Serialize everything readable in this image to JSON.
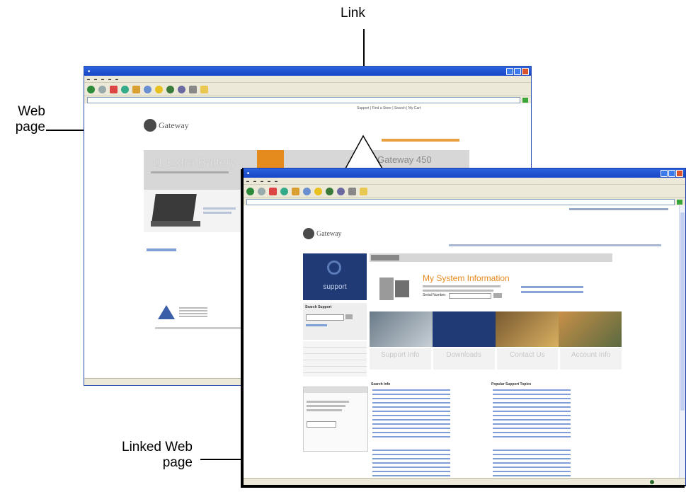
{
  "labels": {
    "link": "Link",
    "web_page_line1": "Web",
    "web_page_line2": "page",
    "linked_line1": "Linked Web",
    "linked_line2": "page"
  },
  "back_window": {
    "logo": "Gateway",
    "banner_text": "11 Extra Battery",
    "banner_right": "Gateway 450",
    "nav_links": "Support | Find a Store | Search | My Cart"
  },
  "front_window": {
    "logo": "Gateway",
    "side_label": "support",
    "section_title": "My System Information",
    "serial_label": "Serial Number:",
    "panels": [
      "Support Info",
      "Downloads",
      "Contact Us",
      "Account Info"
    ],
    "lower_left_title": "Search Info",
    "lower_right_title": "Popular Support Topics",
    "sidebar_title": "Search Support"
  },
  "colors": {
    "accent_blue": "#1f3a74",
    "orange": "#e58a1c",
    "title_blue": "#1846c4"
  }
}
